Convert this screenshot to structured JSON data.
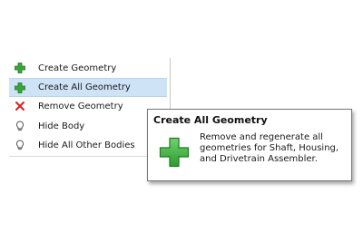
{
  "context_menu": {
    "items": [
      {
        "label": "Create Geometry",
        "icon": "green-plus-icon"
      },
      {
        "label": "Create All Geometry",
        "icon": "green-plus-icon",
        "selected": true
      },
      {
        "label": "Remove Geometry",
        "icon": "red-x-icon"
      },
      {
        "label": "Hide Body",
        "icon": "lightbulb-icon"
      },
      {
        "label": "Hide All Other Bodies",
        "icon": "lightbulb-icon"
      }
    ]
  },
  "tooltip": {
    "title": "Create All Geometry",
    "icon": "green-plus-icon",
    "description": "Remove and regenerate all geometries for Shaft, Housing, and Drivetrain Assembler."
  },
  "colors": {
    "selection": "#cfe3f7",
    "plus_green": "#3aa53a",
    "remove_red": "#d9201e"
  }
}
